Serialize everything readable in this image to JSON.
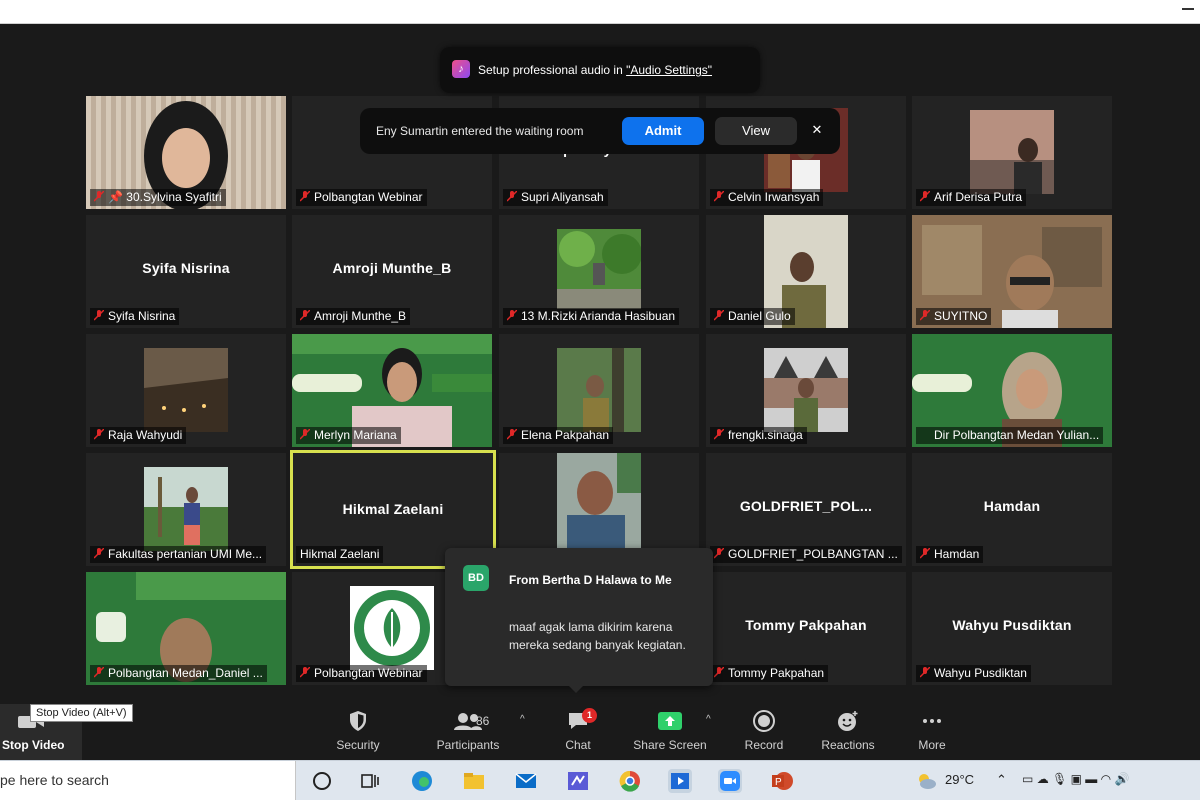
{
  "notifications": {
    "audio": {
      "prefix": "Setup professional audio in ",
      "link": "\"Audio Settings\""
    },
    "waiting": {
      "text": "Eny Sumartin entered the waiting room",
      "admit": "Admit",
      "view": "View",
      "close": "✕"
    }
  },
  "tiles": [
    {
      "name": "30.Sylvina Syafitri",
      "center": "",
      "pinned": true
    },
    {
      "name": "Polbangtan Webinar",
      "center": ""
    },
    {
      "name": "Supri Aliyansah",
      "center": "Supri Aliyansah"
    },
    {
      "name": "Celvin Irwansyah",
      "center": ""
    },
    {
      "name": "Arif Derisa Putra",
      "center": ""
    },
    {
      "name": "Syifa Nisrina",
      "center": "Syifa Nisrina"
    },
    {
      "name": "Amroji Munthe_B",
      "center": "Amroji Munthe_B"
    },
    {
      "name": "13 M.Rizki Arianda Hasibuan",
      "center": ""
    },
    {
      "name": "Daniel Gulo",
      "center": ""
    },
    {
      "name": "SUYITNO",
      "center": ""
    },
    {
      "name": "Raja Wahyudi",
      "center": ""
    },
    {
      "name": "Merlyn Mariana",
      "center": ""
    },
    {
      "name": "Elena Pakpahan",
      "center": ""
    },
    {
      "name": "frengki.sinaga",
      "center": ""
    },
    {
      "name": "Dir Polbangtan Medan Yulian...",
      "center": ""
    },
    {
      "name": "Fakultas pertanian UMI Me...",
      "center": ""
    },
    {
      "name": "Hikmal Zaelani",
      "center": "Hikmal Zaelani"
    },
    {
      "name": "",
      "center": ""
    },
    {
      "name": "GOLDFRIET_POLBANGTAN ...",
      "center": "GOLDFRIET_POL..."
    },
    {
      "name": "Hamdan",
      "center": "Hamdan"
    },
    {
      "name": "Polbangtan Medan_Daniel ...",
      "center": ""
    },
    {
      "name": "Polbangtan Webinar",
      "center": ""
    },
    {
      "name": "",
      "center": ""
    },
    {
      "name": "Tommy Pakpahan",
      "center": "Tommy Pakpahan"
    },
    {
      "name": "Wahyu Pusdiktan",
      "center": "Wahyu Pusdiktan"
    }
  ],
  "chat_popup": {
    "avatar": "BD",
    "from": "From Bertha D Halawa to Me",
    "message": "maaf agak lama dikirim karena mereka sedang banyak kegiatan."
  },
  "toolbar": {
    "stop_video": "Stop Video",
    "tooltip": "Stop Video (Alt+V)",
    "security": "Security",
    "participants": "Participants",
    "participants_count": "86",
    "chat": "Chat",
    "chat_badge": "1",
    "share_screen": "Share Screen",
    "record": "Record",
    "reactions": "Reactions",
    "more": "More"
  },
  "taskbar": {
    "search_placeholder": "pe here to search",
    "temperature": "29°C"
  },
  "colors": {
    "meeting_bg": "#1a1a1a",
    "tile_bg": "#232323",
    "admit_blue": "#0e72ed",
    "share_green": "#2fd06b",
    "active_speaker": "#d7e04e",
    "muted_red": "#e02828"
  }
}
